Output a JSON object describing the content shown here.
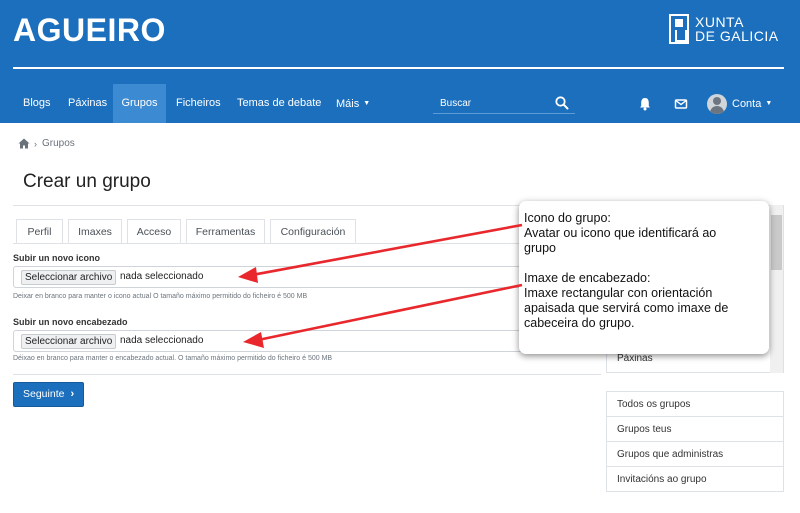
{
  "header": {
    "site_title": "AGUEIRO",
    "logo_line1": "XUNTA",
    "logo_line2": "DE GALICIA",
    "bg_color": "#1b6fbd"
  },
  "nav": {
    "items": [
      "Blogs",
      "Páxinas",
      "Grupos",
      "Ficheiros",
      "Temas de debate",
      "Máis"
    ],
    "active": "Grupos",
    "search_placeholder": "Buscar",
    "account_label": "Conta"
  },
  "breadcrumb": {
    "home_icon": "home-icon",
    "current": "Grupos"
  },
  "page_title": "Crear un grupo",
  "tabs": [
    "Perfil",
    "Imaxes",
    "Acceso",
    "Ferramentas",
    "Configuración"
  ],
  "active_tab": "Imaxes",
  "form": {
    "icon_field": {
      "label": "Subir un novo icono",
      "button": "Seleccionar archivo",
      "status": "nada seleccionado",
      "help": "Deixar en branco para manter o icono actual O tamaño máximo permitido do ficheiro é 500 MB"
    },
    "header_field": {
      "label": "Subir un novo encabezado",
      "button": "Seleccionar archivo",
      "status": "nada seleccionado",
      "help": "Déixao en branco para manter o encabezado actual. O tamaño máximo permitido do ficheiro é 500 MB"
    },
    "next_button": "Seguinte"
  },
  "sidebar": {
    "top_visible_item": "Páxinas",
    "menu": [
      "Todos os grupos",
      "Grupos teus",
      "Grupos que administras",
      "Invitacións ao grupo"
    ]
  },
  "callout": {
    "lines_1": [
      "Icono do grupo:",
      "Avatar ou icono que identificará ao",
      "grupo"
    ],
    "lines_2": [
      "Imaxe de encabezado:",
      "Imaxe rectangular con orientación",
      "apaisada que servirá como imaxe de",
      "cabeceira do grupo."
    ]
  },
  "colors": {
    "primary": "#1b6fbd",
    "nav_active": "#3b8ad2",
    "arrow": "#e8282c"
  }
}
